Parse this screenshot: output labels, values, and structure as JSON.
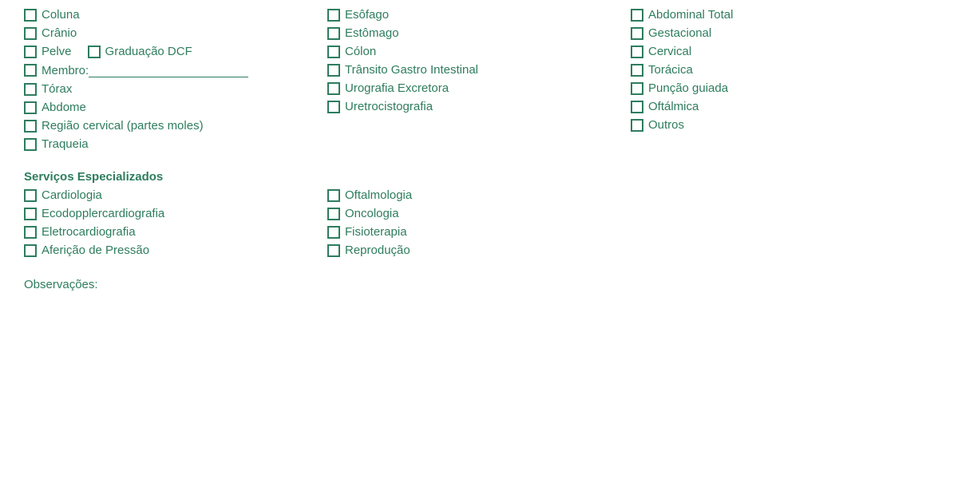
{
  "col1": {
    "items": [
      "Coluna",
      "Crânio",
      "Pelve",
      "Membro:",
      "Tórax",
      "Abdome",
      "Região cervical (partes moles)",
      "Traqueia"
    ],
    "pelve_extra": "Graduação DCF"
  },
  "col2": {
    "items": [
      "Esôfago",
      "Estômago",
      "Cólon",
      "Trânsito Gastro Intestinal",
      "Urografia Excretora",
      "Uretrocistografia"
    ]
  },
  "col3": {
    "items": [
      "Abdominal Total",
      "Gestacional",
      "Cervical",
      "Torácica",
      "Punção guiada",
      "Oftálmica",
      "Outros"
    ]
  },
  "servicos": {
    "title": "Serviços Especializados",
    "col1": [
      "Cardiologia",
      "Ecodopplercardiografia",
      "Eletrocardiografia",
      "Aferição de Pressão"
    ],
    "col2": [
      "Oftalmologia",
      "Oncologia",
      "Fisioterapia",
      "Reprodução"
    ]
  },
  "obs_label": "Observações:"
}
